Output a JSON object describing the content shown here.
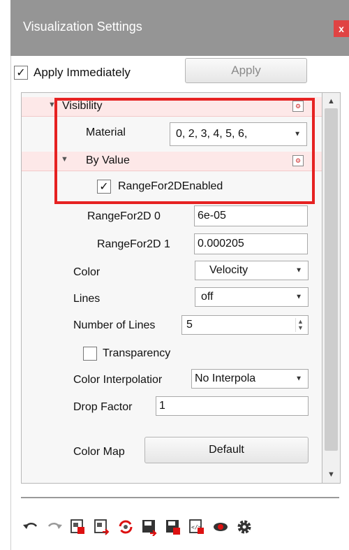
{
  "window": {
    "title": "Visualization Settings",
    "close_label": "x"
  },
  "apply": {
    "checkbox_mark": "✓",
    "immediate_label": "Apply Immediately",
    "button_label": "Apply"
  },
  "tree": {
    "visibility_label": "Visibility",
    "material": {
      "label": "Material",
      "value": "0, 2, 3, 4, 5, 6,"
    },
    "by_value_label": "By Value",
    "range_enabled": {
      "mark": "✓",
      "label": "RangeFor2DEnabled"
    },
    "range0": {
      "label": "RangeFor2D 0",
      "value": "6e-05"
    },
    "range1": {
      "label": "RangeFor2D 1",
      "value": "0.000205"
    },
    "color": {
      "label": "Color",
      "value": "Velocity"
    },
    "lines": {
      "label": "Lines",
      "value": "off"
    },
    "num_lines": {
      "label": "Number of Lines",
      "value": "5"
    },
    "transparency": {
      "label": "Transparency"
    },
    "interpolation": {
      "label": "Color Interpolatior",
      "value": "No Interpola"
    },
    "drop_factor": {
      "label": "Drop Factor",
      "value": "1"
    },
    "color_map": {
      "label": "Color Map",
      "value": "Default"
    }
  },
  "toolbar_icons": [
    "undo-icon",
    "redo-icon",
    "copy-settings-icon",
    "paste-settings-icon",
    "sync-icon",
    "save-icon",
    "save-as-icon",
    "script-icon",
    "view-icon",
    "gear-icon"
  ],
  "colors": {
    "highlight": "#e62222",
    "title_bar": "#959595",
    "close": "#e04343"
  }
}
